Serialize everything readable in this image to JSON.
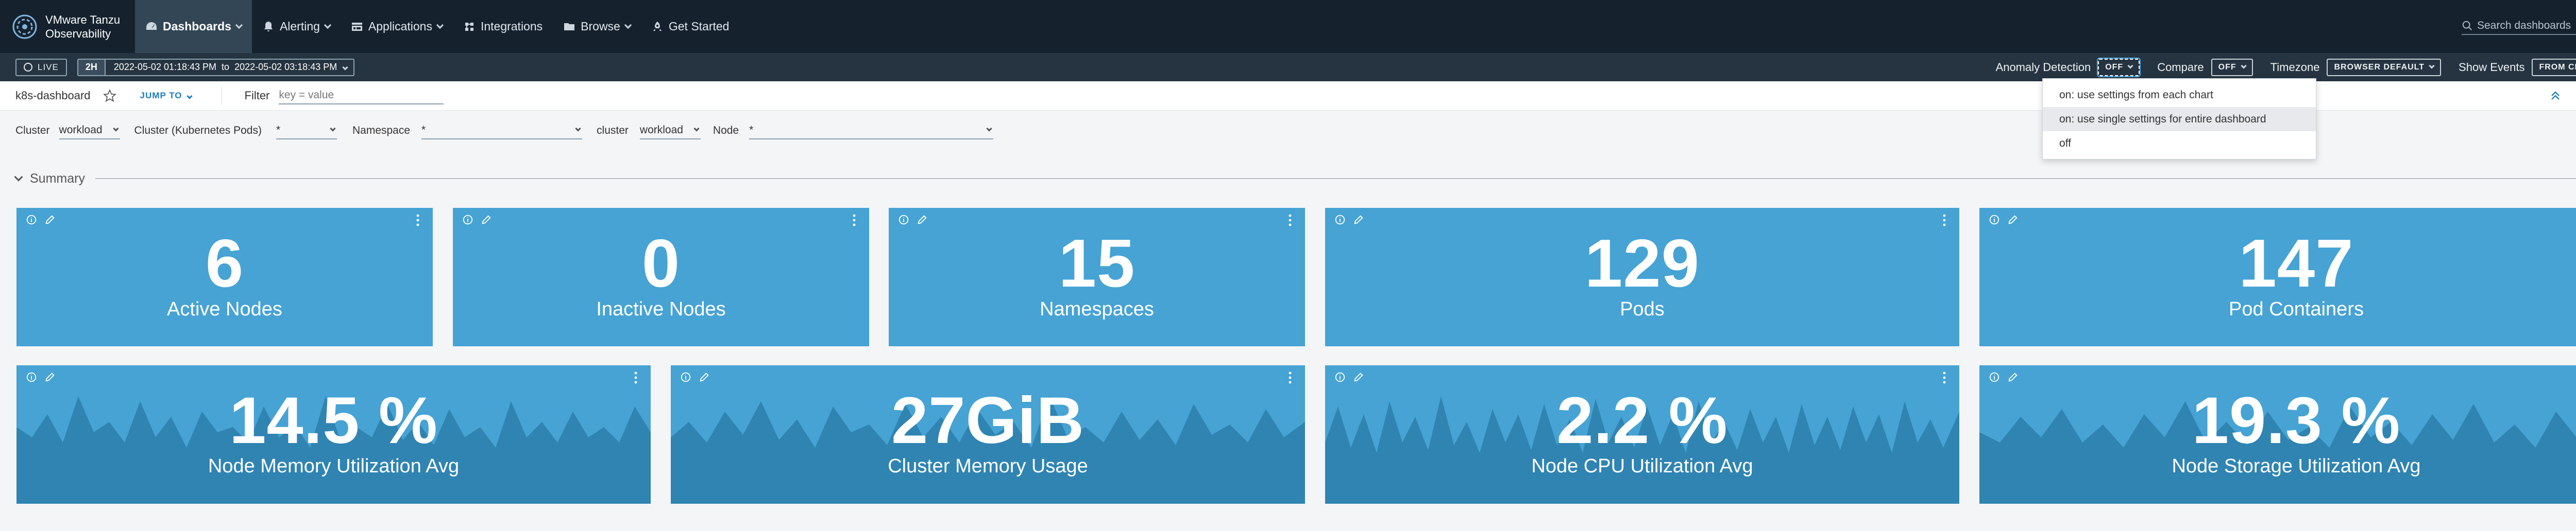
{
  "app": {
    "logo_line1": "VMware Tanzu",
    "logo_line2": "Observability"
  },
  "nav": {
    "items": [
      {
        "label": "Dashboards",
        "icon": "dashboard-icon",
        "active": true
      },
      {
        "label": "Alerting",
        "icon": "bell-icon"
      },
      {
        "label": "Applications",
        "icon": "applications-icon"
      },
      {
        "label": "Integrations",
        "icon": "integrations-icon"
      },
      {
        "label": "Browse",
        "icon": "folder-icon"
      },
      {
        "label": "Get Started",
        "icon": "rocket-icon"
      }
    ],
    "search_placeholder": "Search dashboards"
  },
  "timebar": {
    "live": "LIVE",
    "window": "2H",
    "from": "2022-05-02 01:18:43 PM",
    "to_word": "to",
    "to": "2022-05-02 03:18:43 PM",
    "anomaly_label": "Anomaly Detection",
    "anomaly_value": "OFF",
    "compare_label": "Compare",
    "compare_value": "OFF",
    "timezone_label": "Timezone",
    "timezone_value": "BROWSER DEFAULT",
    "events_label": "Show Events",
    "events_value": "FROM CHART"
  },
  "anomaly_menu": [
    "on: use settings from each chart",
    "on: use single settings for entire dashboard",
    "off"
  ],
  "dashboard": {
    "name": "k8s-dashboard",
    "jump_to": "JUMP TO",
    "filter_label": "Filter",
    "filter_placeholder": "key = value"
  },
  "variables": {
    "cluster_label": "Cluster",
    "cluster_value": "workload",
    "kpods_label": "Cluster (Kubernetes Pods)",
    "kpods_value": "*",
    "namespace_label": "Namespace",
    "namespace_value": "*",
    "cluster2_label": "cluster",
    "cluster2_value": "workload",
    "node_label": "Node",
    "node_value": "*"
  },
  "section": {
    "title": "Summary"
  },
  "stats_row1": [
    {
      "value": "6",
      "label": "Active Nodes"
    },
    {
      "value": "0",
      "label": "Inactive Nodes"
    },
    {
      "value": "15",
      "label": "Namespaces"
    },
    {
      "value": "129",
      "label": "Pods"
    },
    {
      "value": "147",
      "label": "Pod Containers"
    }
  ],
  "stats_row2": [
    {
      "value": "14.5 %",
      "label": "Node Memory Utilization Avg"
    },
    {
      "value": "27GiB",
      "label": "Cluster Memory Usage"
    },
    {
      "value": "2.2 %",
      "label": "Node CPU Utilization Avg"
    },
    {
      "value": "19.3 %",
      "label": "Node Storage Utilization Avg"
    }
  ],
  "colors": {
    "nav_bg": "#15222e",
    "timebar_bg": "#253440",
    "tile_bg": "#46a3d4",
    "sparkline": "#2f84b2",
    "link": "#1f7dc2"
  }
}
